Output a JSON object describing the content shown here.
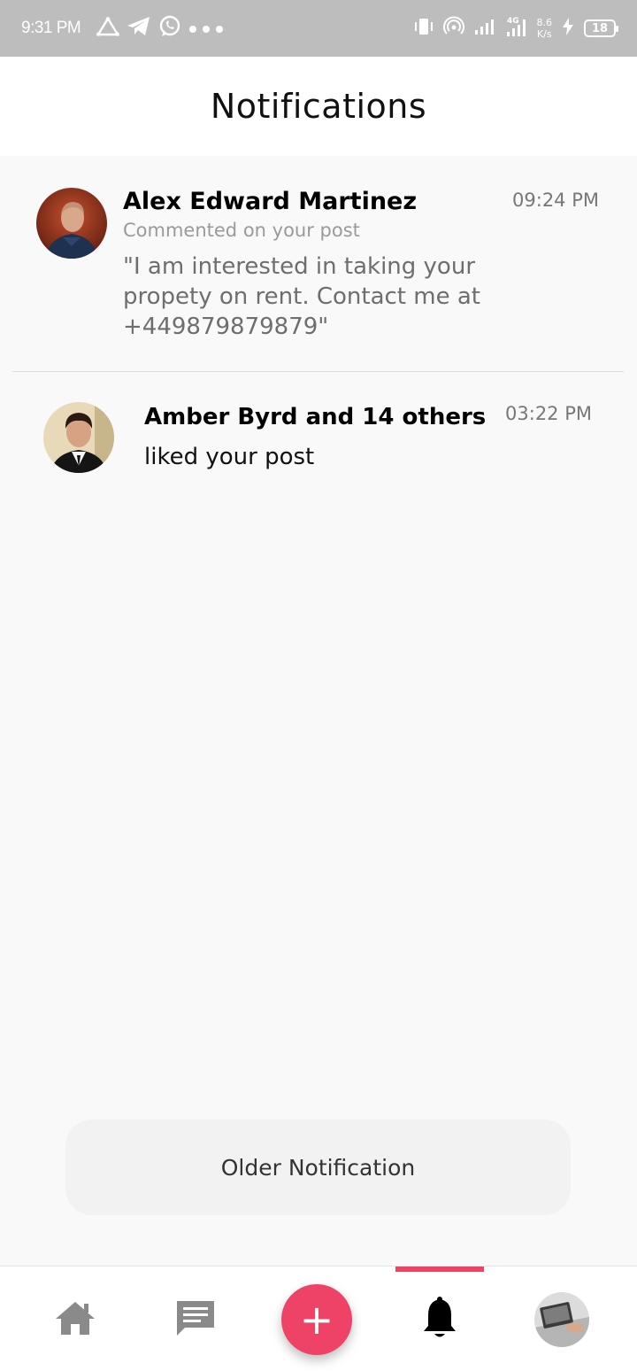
{
  "status_bar": {
    "time": "9:31 PM",
    "speed_value": "8.6",
    "speed_unit": "K/s",
    "battery": "18"
  },
  "header": {
    "title": "Notifications"
  },
  "notifications": [
    {
      "name": "Alex Edward Martinez",
      "subtitle": "Commented on your post",
      "message": "\"I am interested in taking your propety on rent. Contact me at +449879879879\"",
      "time": "09:24 PM"
    },
    {
      "name": "Amber Byrd and 14 others",
      "message": "liked your post",
      "time": "03:22 PM"
    }
  ],
  "older_button": {
    "label": "Older Notification"
  },
  "bottom_nav": {
    "items": [
      "home-icon",
      "chat-icon",
      "add-icon",
      "bell-icon",
      "profile-avatar"
    ],
    "active": "bell-icon",
    "add_symbol": "+"
  },
  "colors": {
    "accent": "#ee4266",
    "status_bar": "#bdbdbd"
  }
}
